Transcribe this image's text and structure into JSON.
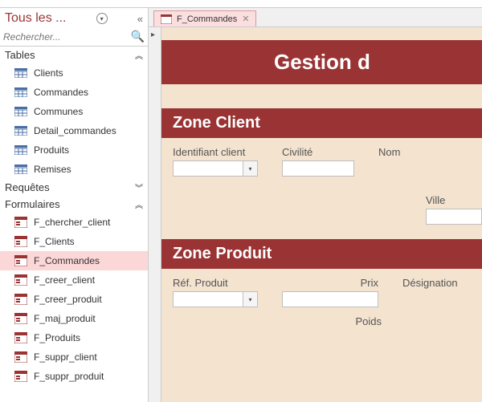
{
  "nav": {
    "title": "Tous les ...",
    "search_placeholder": "Rechercher...",
    "groups": {
      "tables": {
        "label": "Tables",
        "items": [
          "Clients",
          "Commandes",
          "Communes",
          "Detail_commandes",
          "Produits",
          "Remises"
        ]
      },
      "requetes": {
        "label": "Requêtes"
      },
      "formulaires": {
        "label": "Formulaires",
        "items": [
          "F_chercher_client",
          "F_Clients",
          "F_Commandes",
          "F_creer_client",
          "F_creer_produit",
          "F_maj_produit",
          "F_Produits",
          "F_suppr_client",
          "F_suppr_produit"
        ]
      }
    }
  },
  "tab": {
    "label": "F_Commandes"
  },
  "form": {
    "title": "Gestion d",
    "client": {
      "heading": "Zone Client",
      "id_label": "Identifiant client",
      "civilite_label": "Civilité",
      "nom_label": "Nom",
      "ville_label": "Ville"
    },
    "produit": {
      "heading": "Zone Produit",
      "ref_label": "Réf. Produit",
      "prix_label": "Prix",
      "designation_label": "Désignation",
      "poids_label": "Poids"
    }
  }
}
